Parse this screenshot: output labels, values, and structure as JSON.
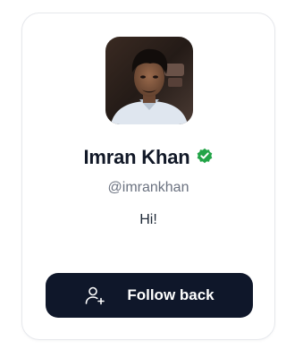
{
  "profile": {
    "name": "Imran Khan",
    "handle": "@imrankhan",
    "bio": "Hi!",
    "verified": true,
    "avatar_icon": "profile-photo"
  },
  "actions": {
    "follow_label": "Follow back",
    "follow_icon": "user-plus-icon"
  },
  "colors": {
    "button_bg": "#0f172a",
    "verified_badge": "#22a447",
    "name_text": "#111827",
    "handle_text": "#6b7280",
    "card_border": "#e6e8ec"
  }
}
